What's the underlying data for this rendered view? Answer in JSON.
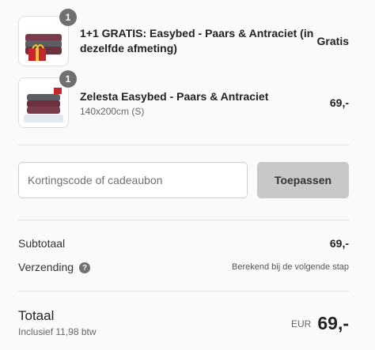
{
  "items": [
    {
      "quantity": "1",
      "name": "1+1 GRATIS: Easybed - Paars & Antraciet (in dezelfde afmeting)",
      "variant": "",
      "price": "Gratis",
      "thumb_icon": "folded-blanket-gift-icon"
    },
    {
      "quantity": "1",
      "name": "Zelesta Easybed - Paars & Antraciet",
      "variant": "140x200cm (S)",
      "price": "69,-",
      "thumb_icon": "folded-blanket-icon"
    }
  ],
  "discount": {
    "placeholder": "Kortingscode of cadeaubon",
    "apply_label": "Toepassen"
  },
  "summary": {
    "subtotal_label": "Subtotaal",
    "subtotal_value": "69,-",
    "shipping_label": "Verzending",
    "shipping_value": "Berekend bij de volgende stap"
  },
  "total": {
    "label": "Totaal",
    "tax_note": "Inclusief 11,98 btw",
    "currency": "EUR",
    "amount": "69,-"
  },
  "colors": {
    "badge": "#707070",
    "button": "#c8c8c8",
    "background": "#fafafa"
  }
}
